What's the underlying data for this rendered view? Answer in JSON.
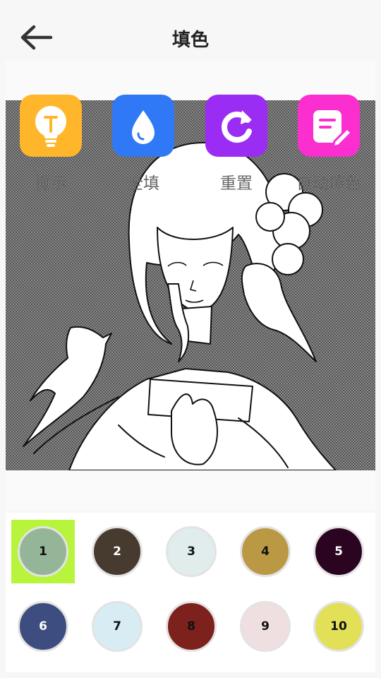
{
  "header": {
    "title": "填色"
  },
  "tools": [
    {
      "label": "提示",
      "color": "#ffb62a",
      "icon": "lightbulb-icon"
    },
    {
      "label": "全填",
      "color": "#2f78f6",
      "icon": "droplet-icon"
    },
    {
      "label": "重置",
      "color": "#9a2cf3",
      "icon": "refresh-icon"
    },
    {
      "label": "自动填色",
      "color": "#fb2ecf",
      "icon": "note-pencil-icon"
    }
  ],
  "palette": {
    "selected": "1",
    "selected_highlight": "#b7f43b",
    "colors": [
      {
        "label": "1",
        "color": "#95b598",
        "text": "#111111"
      },
      {
        "label": "2",
        "color": "#473a2e",
        "text": "#ffffff"
      },
      {
        "label": "3",
        "color": "#e1ecec",
        "text": "#111111"
      },
      {
        "label": "4",
        "color": "#bb9944",
        "text": "#111111"
      },
      {
        "label": "5",
        "color": "#2a0420",
        "text": "#ffffff"
      },
      {
        "label": "6",
        "color": "#3d4d7f",
        "text": "#ffffff"
      },
      {
        "label": "7",
        "color": "#d8edf3",
        "text": "#111111"
      },
      {
        "label": "8",
        "color": "#7c211c",
        "text": "#111111"
      },
      {
        "label": "9",
        "color": "#f0dfe0",
        "text": "#111111"
      },
      {
        "label": "10",
        "color": "#e2e056",
        "text": "#111111"
      }
    ]
  }
}
